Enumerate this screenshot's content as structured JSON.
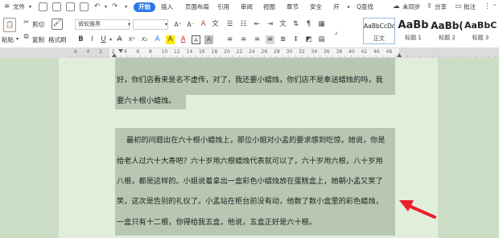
{
  "menubar": {
    "file": "文件",
    "dropdown_arrow": "▾",
    "tabs": [
      "开始",
      "插入",
      "页面布局",
      "引用",
      "审阅",
      "视图",
      "章节",
      "安全",
      "开"
    ],
    "active_tab": "开始",
    "search": "Q查找",
    "sync": "未同步",
    "share": "分享",
    "batch": "批注"
  },
  "toolbar": {
    "cut": "剪切",
    "copy": "复制",
    "paste": "粘贴",
    "format_painter": "格式刷",
    "font_name": "微软雅黑",
    "font_size": "",
    "font_size_up": "A⁺",
    "font_size_down": "A⁻",
    "bold": "B",
    "italic": "I",
    "underline": "U",
    "strike": "A",
    "superscript": "X²",
    "subscript": "X₂",
    "font_color": "A",
    "highlight": "A",
    "clear": "A"
  },
  "styles": [
    {
      "preview": "AaBbCcDd",
      "label": "正文"
    },
    {
      "preview": "AaBb",
      "label": "标题 1"
    },
    {
      "preview": "AaBb(",
      "label": "标题 2"
    },
    {
      "preview": "AaBbC",
      "label": "标题 3"
    }
  ],
  "ruler": {
    "numbers": [
      "6",
      "4",
      "2",
      "2",
      "4",
      "6",
      "8",
      "10",
      "12",
      "14",
      "16",
      "18",
      "20",
      "22",
      "24",
      "26",
      "28",
      "30",
      "32",
      "34",
      "36",
      "38",
      "40",
      "42",
      "46",
      "48"
    ]
  },
  "document": {
    "lines": [
      "好，你们店看来是名不虚传，对了，我还要小蜡烛，你们店不是奉送蜡烛的吗，我",
      "要六十根小蜡烛。",
      "最初的问题出在六十根小蜡烛上，那位小姐对小孟的要求感到吃惊，她说，你是",
      "给老人过六十大寿吧？六十岁用六根蜡烛代表就可以了，六十岁用六根，八十岁用",
      "八根，都是这样的。小姐说着拿出一盒彩色小蜡烛放在蛋糕盒上，她朝小孟又笑了",
      "笑，这次是告别的礼仪了。小孟站在柜台前没有动，他数了数小盒里的彩色蜡烛，",
      "一盒只有十二根，你得给我五盒，他说，五盒正好是六十根。"
    ]
  },
  "colors": {
    "accent": "#2b78e4",
    "page_bg": "#e2eedc",
    "highlight": "#b7c7b1",
    "arrow": "#e8202a"
  }
}
